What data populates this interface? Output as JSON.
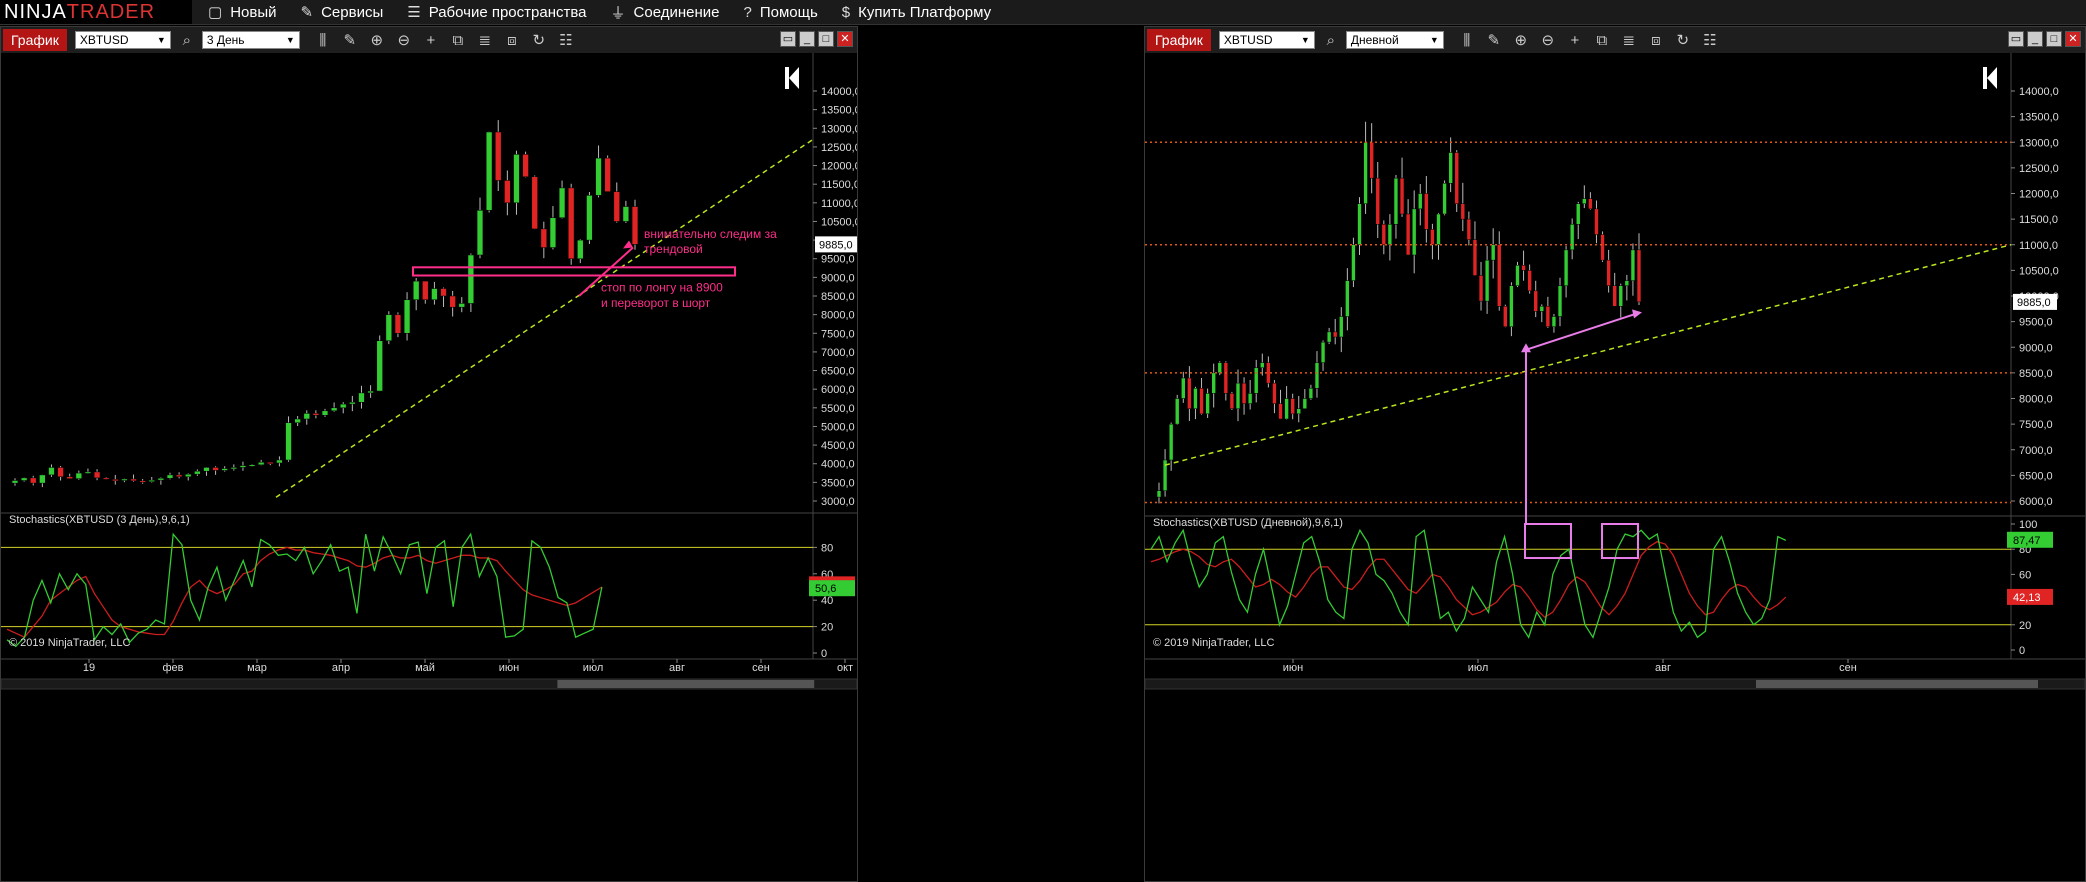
{
  "app": {
    "logo_left": "NINJA",
    "logo_right": "TRADER",
    "menu": [
      {
        "icon": "new-doc-icon",
        "glyph": "▢",
        "label": "Новый"
      },
      {
        "icon": "wrench-icon",
        "glyph": "✎",
        "label": "Сервисы"
      },
      {
        "icon": "workspace-icon",
        "glyph": "☰",
        "label": "Рабочие пространства"
      },
      {
        "icon": "plug-icon",
        "glyph": "⏚",
        "label": "Соединение"
      },
      {
        "icon": "help-icon",
        "glyph": "?",
        "label": "Помощь"
      },
      {
        "icon": "dollar-icon",
        "glyph": "$",
        "label": "Купить Платформу"
      }
    ]
  },
  "charts": [
    {
      "tab": "График",
      "instrument": "XBTUSD",
      "period": "3 День",
      "price_ticks": [
        "14000,0",
        "13500,0",
        "13000,0",
        "12500,0",
        "12000,0",
        "11500,0",
        "11000,0",
        "10500,0",
        "10000,0",
        "9500,0",
        "9000,0",
        "8500,0",
        "8000,0",
        "7500,0",
        "7000,0",
        "6500,0",
        "6000,0",
        "5500,0",
        "5000,0",
        "4500,0",
        "4000,0",
        "3500,0",
        "3000,0"
      ],
      "last_price": "9885,0",
      "indicator_title": "Stochastics(XBTUSD (3 День),9,6,1)",
      "indicator_ticks": [
        "80",
        "60",
        "40",
        "20",
        "0"
      ],
      "indicator_tag_red": "50,1",
      "indicator_tag_green": "50,6",
      "copyright": "© 2019 NinjaTrader, LLC",
      "x_labels": [
        "19",
        "фев",
        "мар",
        "апр",
        "май",
        "июн",
        "июл",
        "авг",
        "сен",
        "окт"
      ],
      "annotations": [
        {
          "text": "внимательно следим за",
          "color": "#ff2e8a"
        },
        {
          "text": "трендовой",
          "color": "#ff2e8a"
        },
        {
          "text": "стоп по лонгу на 8900",
          "color": "#ff2e8a"
        },
        {
          "text": "и переворот в шорт",
          "color": "#ff2e8a"
        }
      ]
    },
    {
      "tab": "График",
      "instrument": "XBTUSD",
      "period": "Дневной",
      "price_ticks": [
        "14000,0",
        "13500,0",
        "13000,0",
        "12500,0",
        "12000,0",
        "11500,0",
        "11000,0",
        "10500,0",
        "10000,0",
        "9500,0",
        "9000,0",
        "8500,0",
        "8000,0",
        "7500,0",
        "7000,0",
        "6500,0",
        "6000,0"
      ],
      "last_price": "9885,0",
      "indicator_title": "Stochastics(XBTUSD (Дневной),9,6,1)",
      "indicator_ticks": [
        "100",
        "80",
        "60",
        "40",
        "20",
        "0"
      ],
      "indicator_tag_green": "87,47",
      "indicator_tag_red": "42,13",
      "copyright": "© 2019 NinjaTrader, LLC",
      "x_labels": [
        "июн",
        "июл",
        "авг",
        "сен"
      ]
    }
  ],
  "colors": {
    "bull": "#33cc33",
    "bear": "#e02424",
    "trendline": "#b9e61e",
    "annotation": "#ff2e8a",
    "arrow": "#e87ce8",
    "level": "#e0561a",
    "stoch_k": "#33cc33",
    "stoch_d": "#cc1d1d",
    "stoch_level": "#d4d425"
  }
}
